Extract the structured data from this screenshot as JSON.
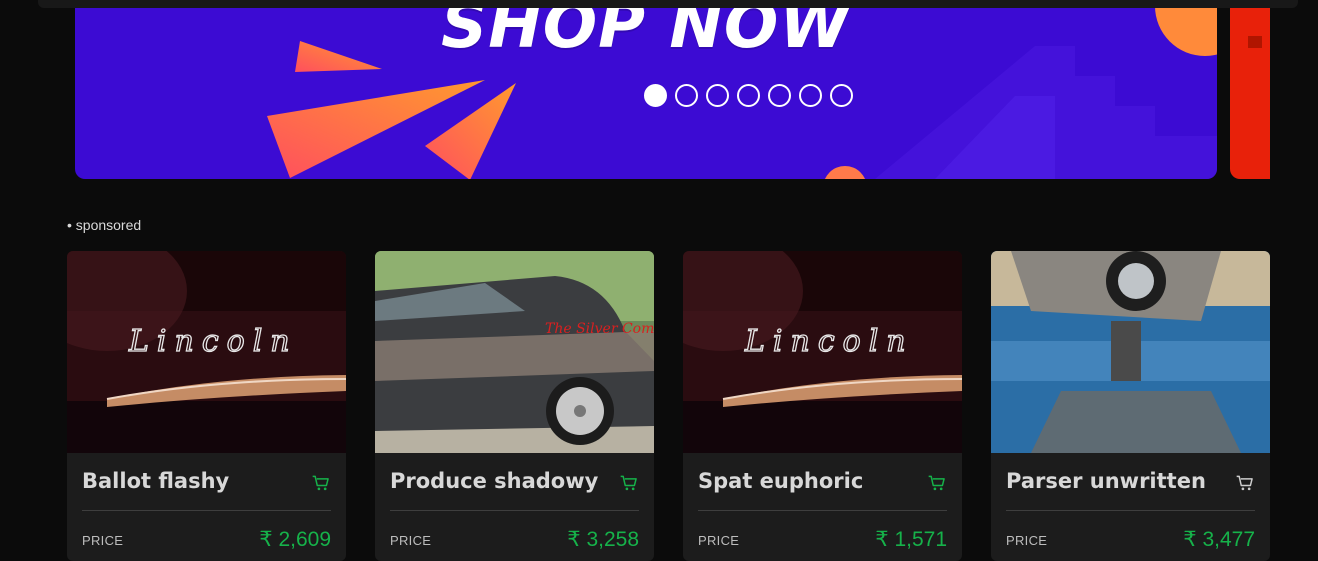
{
  "banner": {
    "headline": "SHOP NOW",
    "slide_count": 7,
    "active_slide": 1,
    "background_color": "#3c0bd3",
    "accent_color": "#ff5a3c"
  },
  "section": {
    "label": "• sponsored"
  },
  "products": [
    {
      "title": "Ballot flashy",
      "price_label": "PRICE",
      "price": "₹ 2,609",
      "image": "lincoln-script-emblem"
    },
    {
      "title": "Produce shadowy",
      "price_label": "PRICE",
      "price": "₹ 3,258",
      "image": "lowrider-car-side"
    },
    {
      "title": "Spat euphoric",
      "price_label": "PRICE",
      "price": "₹ 1,571",
      "image": "lincoln-script-emblem"
    },
    {
      "title": "Parser unwritten",
      "price_label": "PRICE",
      "price": "₹ 3,477",
      "image": "upturned-car-reflection"
    }
  ],
  "colors": {
    "price": "#16b24a",
    "cart_active": "#16b24a",
    "cart_inactive": "#cccccc"
  }
}
